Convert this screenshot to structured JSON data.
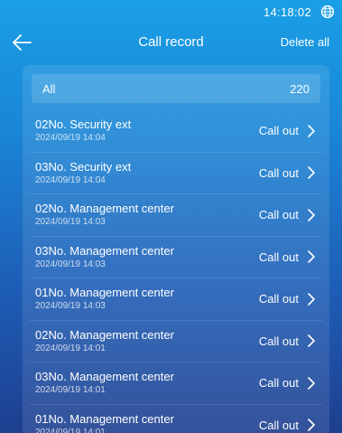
{
  "status": {
    "time": "14:18:02",
    "globe_icon": "globe-icon"
  },
  "header": {
    "back_icon": "arrow-left-icon",
    "title": "Call record",
    "delete_all": "Delete all"
  },
  "summary": {
    "label": "All",
    "count": "220"
  },
  "records": [
    {
      "name": "02No. Security ext",
      "time": "2024/09/19 14:04",
      "action": "Call out"
    },
    {
      "name": "03No. Security ext",
      "time": "2024/09/19 14:04",
      "action": "Call out"
    },
    {
      "name": "02No. Management center",
      "time": "2024/09/19 14:03",
      "action": "Call out"
    },
    {
      "name": "03No. Management center",
      "time": "2024/09/19 14:03",
      "action": "Call out"
    },
    {
      "name": "01No. Management center",
      "time": "2024/09/19 14:03",
      "action": "Call out"
    },
    {
      "name": "02No. Management center",
      "time": "2024/09/19 14:01",
      "action": "Call out"
    },
    {
      "name": "03No. Management center",
      "time": "2024/09/19 14:01",
      "action": "Call out"
    },
    {
      "name": "01No. Management center",
      "time": "2024/09/19 14:01",
      "action": "Call out"
    }
  ]
}
